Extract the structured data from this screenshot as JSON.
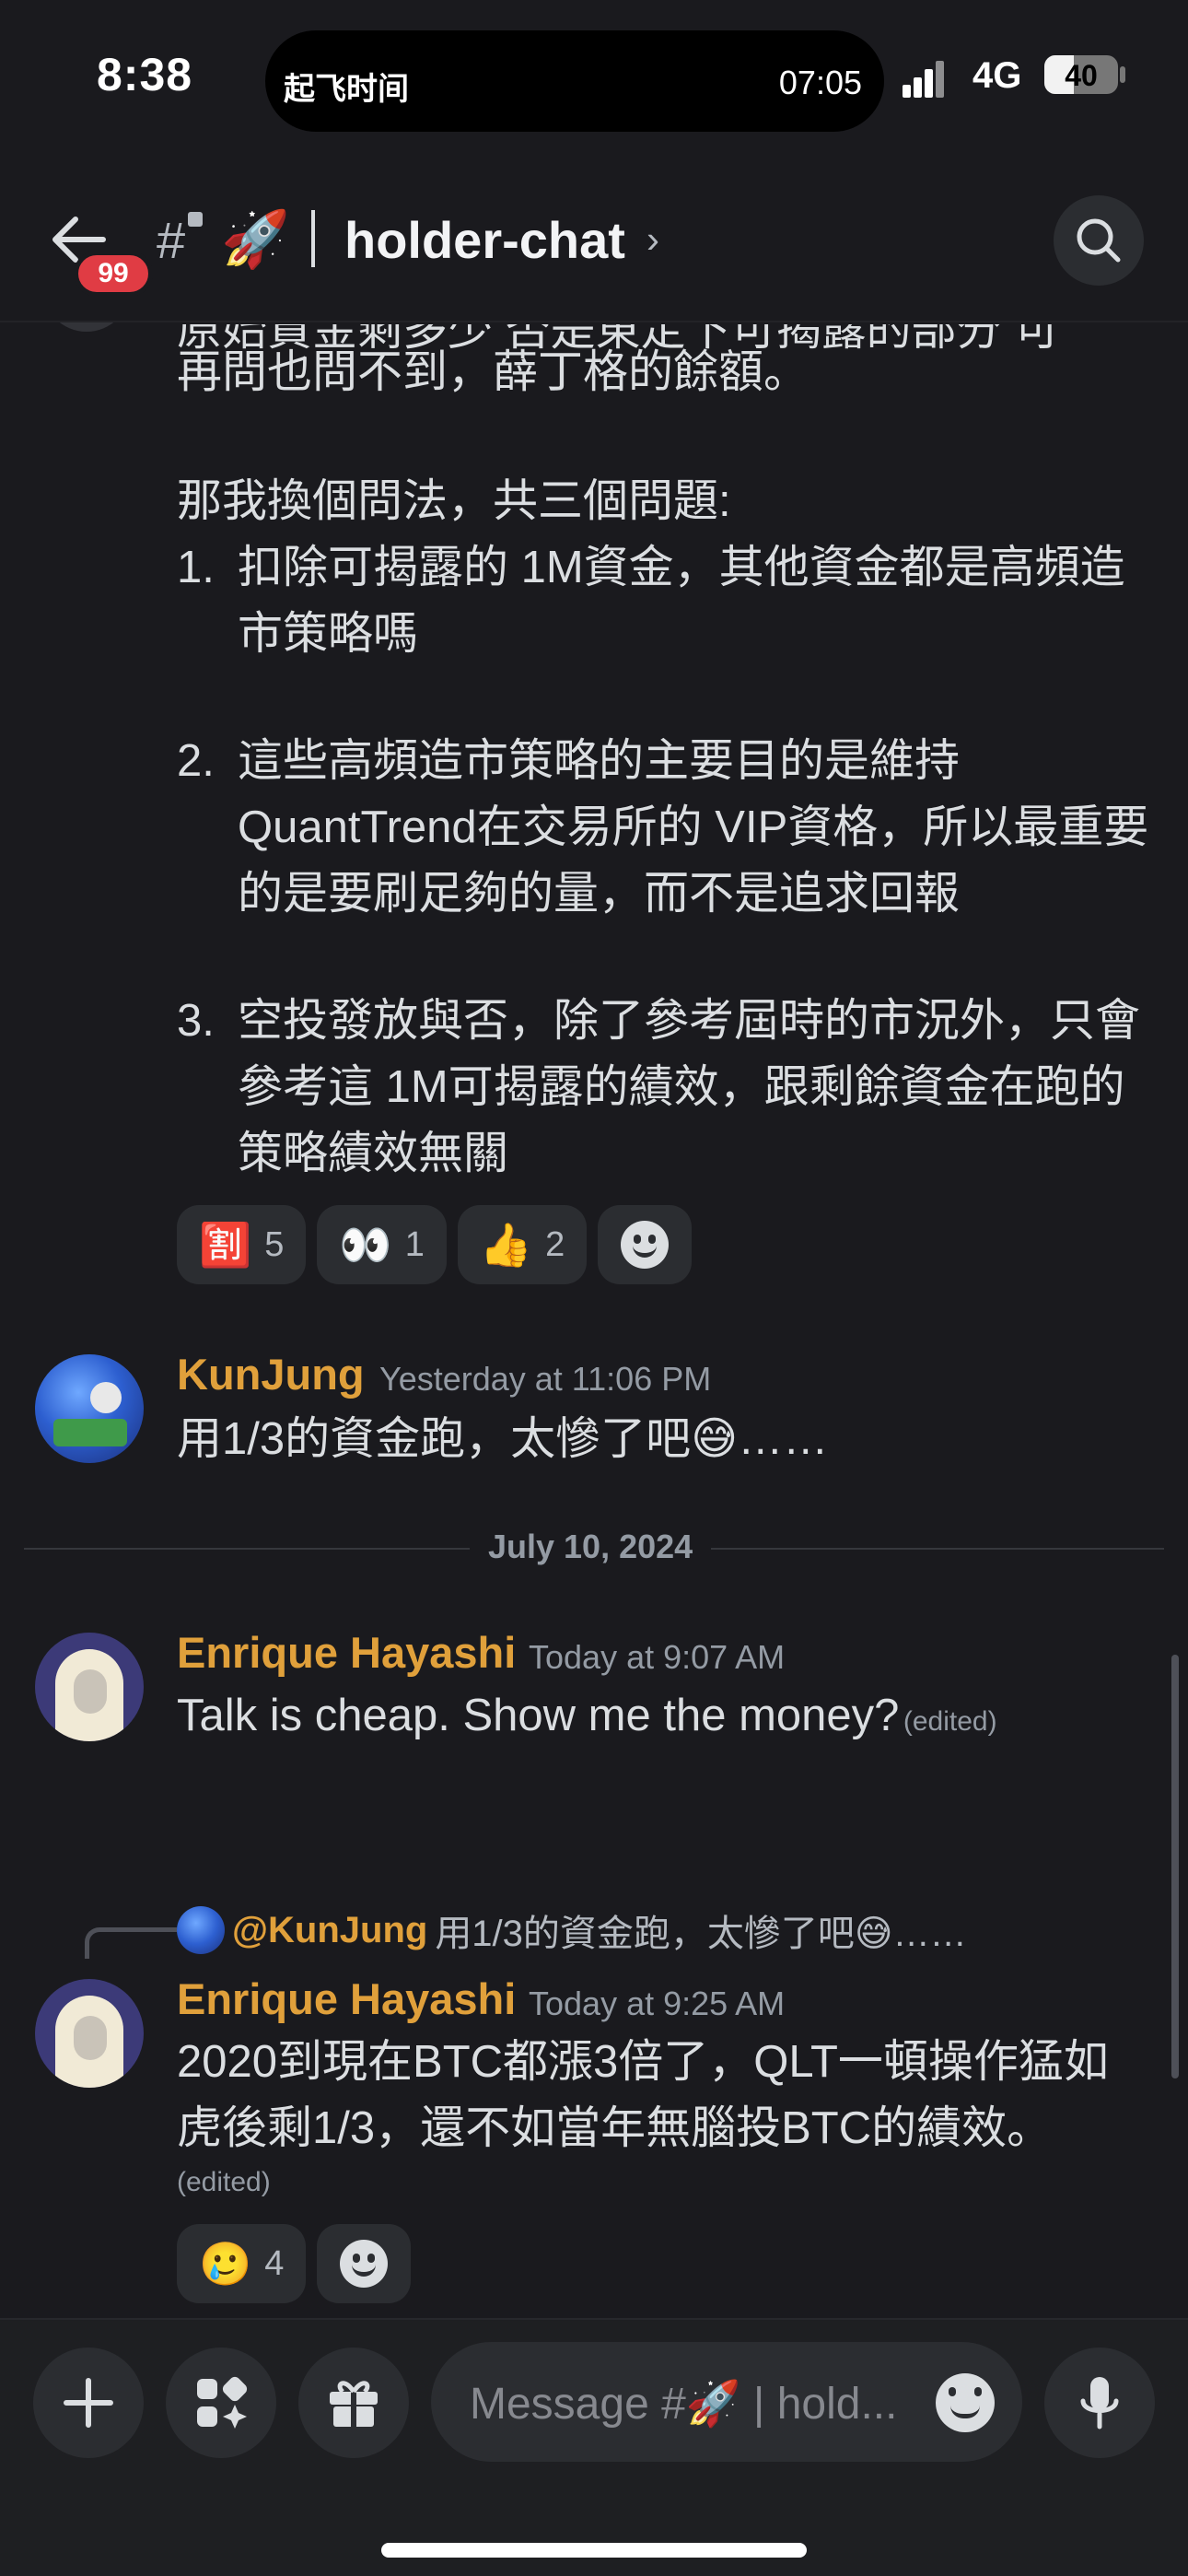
{
  "status_bar": {
    "time": "8:38",
    "island_app": "起飞时间",
    "island_clock": "07:05",
    "network": "4G",
    "battery": "40"
  },
  "header": {
    "back_badge": "99",
    "hash": "#",
    "channel_emoji": "🚀",
    "channel_name": "holder-chat",
    "chevron": "›"
  },
  "messages": {
    "partial_top_line": "原始資金剩多少 否是東定下可揭露的部分 可",
    "msg1": {
      "line": "再問也問不到，薛丁格的餘額。",
      "intro": "那我換個問法，共三個問題:",
      "items": [
        {
          "num": "1.",
          "text": "扣除可揭露的 1M資金，其他資金都是高頻造市策略嗎"
        },
        {
          "num": "2.",
          "text": "這些高頻造市策略的主要目的是維持QuantTrend在交易所的 VIP資格，所以最重要的是要刷足夠的量，而不是追求回報"
        },
        {
          "num": "3.",
          "text": "空投發放與否，除了參考屆時的市況外，只會參考這 1M可揭露的績效，跟剩餘資金在跑的策略績效無關"
        }
      ],
      "reactions": [
        {
          "emoji": "🈹",
          "count": "5"
        },
        {
          "emoji": "👀",
          "count": "1"
        },
        {
          "emoji": "👍",
          "count": "2"
        }
      ]
    },
    "msg2": {
      "author": "KunJung",
      "timestamp": "Yesterday at 11:06 PM",
      "text": "用1/3的資金跑，太慘了吧😅……"
    },
    "date_divider": "July 10, 2024",
    "msg3": {
      "author": "Enrique Hayashi",
      "timestamp": "Today at 9:07 AM",
      "text": "Talk is cheap. Show me the money?",
      "edited": "(edited)"
    },
    "msg4": {
      "reply_to": "@KunJung",
      "reply_preview": "用1/3的資金跑，太慘了吧😅……",
      "author": "Enrique Hayashi",
      "timestamp": "Today at 9:25 AM",
      "text": "2020到現在BTC都漲3倍了，QLT一頓操作猛如虎後剩1/3，還不如當年無腦投BTC的績效。",
      "edited": "(edited)",
      "reactions": [
        {
          "emoji": "🥲",
          "count": "4"
        }
      ]
    }
  },
  "composer": {
    "placeholder": "Message #🚀 | hold..."
  },
  "colors": {
    "background": "#1a1a1e",
    "username": "#e0a03b",
    "badge": "#e03c44",
    "chip": "#2b2d31"
  }
}
